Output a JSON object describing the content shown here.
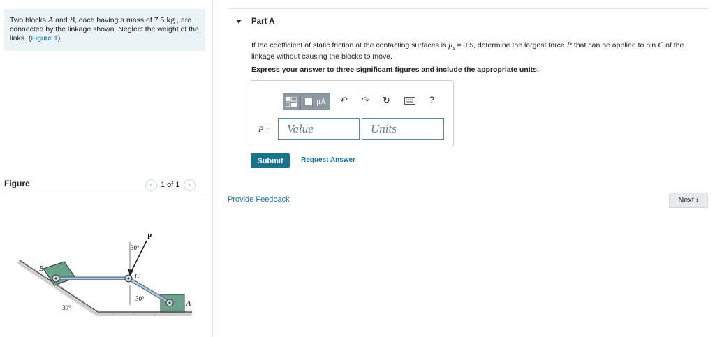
{
  "problem": {
    "text_before_A": "Two blocks ",
    "var_A": "A",
    "text_and": " and ",
    "var_B": "B",
    "text_mass": ", each having a mass of 7.5 ",
    "unit_kg": "kg",
    "text_rest": " , are connected by the linkage shown. Neglect the weight of the links. (",
    "figure_link": "Figure 1",
    "text_close": ")"
  },
  "figure": {
    "title": "Figure",
    "pager_text": "1 of 1",
    "labels": {
      "P": "P",
      "C": "C",
      "A": "A",
      "B": "B",
      "angle_top": "30°",
      "angle_mid": "30°",
      "angle_slope": "30°"
    }
  },
  "part": {
    "title": "Part A",
    "question_1": "If the coefficient of static friction at the contacting surfaces is ",
    "mu": "μ",
    "mu_sub": "s",
    "question_2": " = 0.5, determine the largest force ",
    "var_P": "P",
    "question_3": " that can be applied to pin ",
    "var_C": "C",
    "question_4": " of the linkage without causing the blocks to move.",
    "instructions": "Express your answer to three significant figures and include the appropriate units.",
    "toolbar": {
      "template_label": "",
      "units_label": "μÅ",
      "help_label": "?"
    },
    "answer_label": "P",
    "answer_eq": " =",
    "value_placeholder": "Value",
    "units_placeholder": "Units",
    "submit_label": "Submit",
    "request_answer_label": "Request Answer"
  },
  "footer": {
    "feedback_label": "Provide Feedback",
    "next_label": "Next"
  },
  "colors": {
    "accent": "#19738f",
    "link": "#1a6fa8",
    "problem_bg": "#eaf4f7",
    "block_fill": "#6aa38a"
  }
}
